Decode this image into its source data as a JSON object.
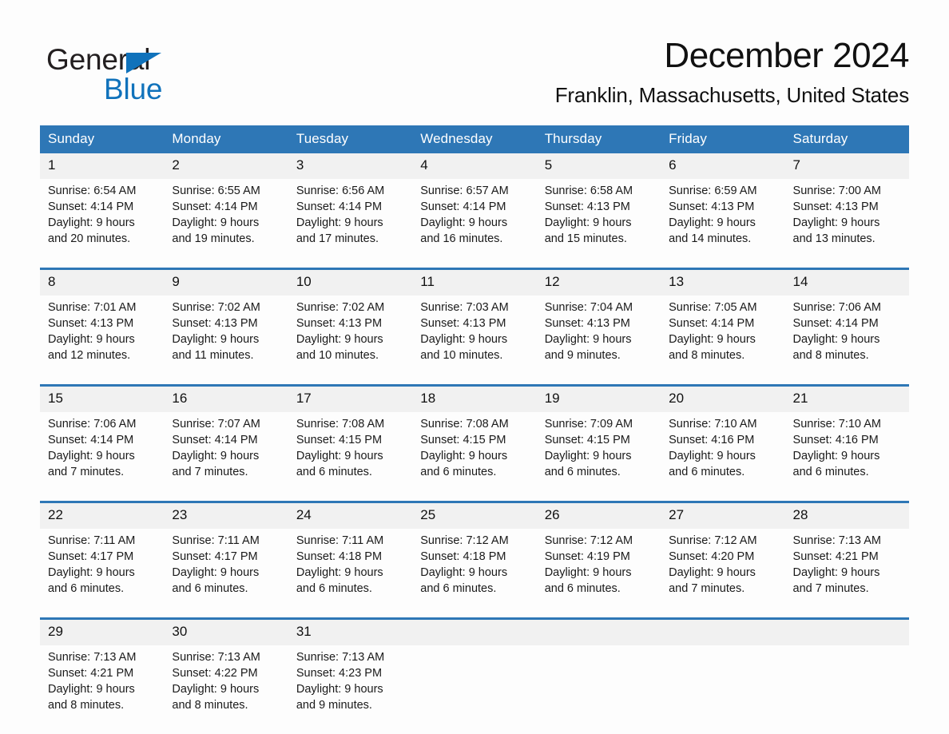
{
  "brand": {
    "name_part1": "General",
    "name_part2": "Blue",
    "triangle_color": "#1072bb",
    "text_color": "#231f20"
  },
  "header": {
    "title": "December 2024",
    "subtitle": "Franklin, Massachusetts, United States"
  },
  "theme": {
    "header_bg": "#2e77b6",
    "header_text": "#ffffff",
    "daynum_bg": "#f1f1f1",
    "page_bg": "#fdfdfd"
  },
  "calendar": {
    "weekday_headers": [
      "Sunday",
      "Monday",
      "Tuesday",
      "Wednesday",
      "Thursday",
      "Friday",
      "Saturday"
    ],
    "weeks": [
      {
        "days": [
          {
            "num": "1",
            "sunrise": "Sunrise: 6:54 AM",
            "sunset": "Sunset: 4:14 PM",
            "daylight_line1": "Daylight: 9 hours",
            "daylight_line2": "and 20 minutes."
          },
          {
            "num": "2",
            "sunrise": "Sunrise: 6:55 AM",
            "sunset": "Sunset: 4:14 PM",
            "daylight_line1": "Daylight: 9 hours",
            "daylight_line2": "and 19 minutes."
          },
          {
            "num": "3",
            "sunrise": "Sunrise: 6:56 AM",
            "sunset": "Sunset: 4:14 PM",
            "daylight_line1": "Daylight: 9 hours",
            "daylight_line2": "and 17 minutes."
          },
          {
            "num": "4",
            "sunrise": "Sunrise: 6:57 AM",
            "sunset": "Sunset: 4:14 PM",
            "daylight_line1": "Daylight: 9 hours",
            "daylight_line2": "and 16 minutes."
          },
          {
            "num": "5",
            "sunrise": "Sunrise: 6:58 AM",
            "sunset": "Sunset: 4:13 PM",
            "daylight_line1": "Daylight: 9 hours",
            "daylight_line2": "and 15 minutes."
          },
          {
            "num": "6",
            "sunrise": "Sunrise: 6:59 AM",
            "sunset": "Sunset: 4:13 PM",
            "daylight_line1": "Daylight: 9 hours",
            "daylight_line2": "and 14 minutes."
          },
          {
            "num": "7",
            "sunrise": "Sunrise: 7:00 AM",
            "sunset": "Sunset: 4:13 PM",
            "daylight_line1": "Daylight: 9 hours",
            "daylight_line2": "and 13 minutes."
          }
        ]
      },
      {
        "days": [
          {
            "num": "8",
            "sunrise": "Sunrise: 7:01 AM",
            "sunset": "Sunset: 4:13 PM",
            "daylight_line1": "Daylight: 9 hours",
            "daylight_line2": "and 12 minutes."
          },
          {
            "num": "9",
            "sunrise": "Sunrise: 7:02 AM",
            "sunset": "Sunset: 4:13 PM",
            "daylight_line1": "Daylight: 9 hours",
            "daylight_line2": "and 11 minutes."
          },
          {
            "num": "10",
            "sunrise": "Sunrise: 7:02 AM",
            "sunset": "Sunset: 4:13 PM",
            "daylight_line1": "Daylight: 9 hours",
            "daylight_line2": "and 10 minutes."
          },
          {
            "num": "11",
            "sunrise": "Sunrise: 7:03 AM",
            "sunset": "Sunset: 4:13 PM",
            "daylight_line1": "Daylight: 9 hours",
            "daylight_line2": "and 10 minutes."
          },
          {
            "num": "12",
            "sunrise": "Sunrise: 7:04 AM",
            "sunset": "Sunset: 4:13 PM",
            "daylight_line1": "Daylight: 9 hours",
            "daylight_line2": "and 9 minutes."
          },
          {
            "num": "13",
            "sunrise": "Sunrise: 7:05 AM",
            "sunset": "Sunset: 4:14 PM",
            "daylight_line1": "Daylight: 9 hours",
            "daylight_line2": "and 8 minutes."
          },
          {
            "num": "14",
            "sunrise": "Sunrise: 7:06 AM",
            "sunset": "Sunset: 4:14 PM",
            "daylight_line1": "Daylight: 9 hours",
            "daylight_line2": "and 8 minutes."
          }
        ]
      },
      {
        "days": [
          {
            "num": "15",
            "sunrise": "Sunrise: 7:06 AM",
            "sunset": "Sunset: 4:14 PM",
            "daylight_line1": "Daylight: 9 hours",
            "daylight_line2": "and 7 minutes."
          },
          {
            "num": "16",
            "sunrise": "Sunrise: 7:07 AM",
            "sunset": "Sunset: 4:14 PM",
            "daylight_line1": "Daylight: 9 hours",
            "daylight_line2": "and 7 minutes."
          },
          {
            "num": "17",
            "sunrise": "Sunrise: 7:08 AM",
            "sunset": "Sunset: 4:15 PM",
            "daylight_line1": "Daylight: 9 hours",
            "daylight_line2": "and 6 minutes."
          },
          {
            "num": "18",
            "sunrise": "Sunrise: 7:08 AM",
            "sunset": "Sunset: 4:15 PM",
            "daylight_line1": "Daylight: 9 hours",
            "daylight_line2": "and 6 minutes."
          },
          {
            "num": "19",
            "sunrise": "Sunrise: 7:09 AM",
            "sunset": "Sunset: 4:15 PM",
            "daylight_line1": "Daylight: 9 hours",
            "daylight_line2": "and 6 minutes."
          },
          {
            "num": "20",
            "sunrise": "Sunrise: 7:10 AM",
            "sunset": "Sunset: 4:16 PM",
            "daylight_line1": "Daylight: 9 hours",
            "daylight_line2": "and 6 minutes."
          },
          {
            "num": "21",
            "sunrise": "Sunrise: 7:10 AM",
            "sunset": "Sunset: 4:16 PM",
            "daylight_line1": "Daylight: 9 hours",
            "daylight_line2": "and 6 minutes."
          }
        ]
      },
      {
        "days": [
          {
            "num": "22",
            "sunrise": "Sunrise: 7:11 AM",
            "sunset": "Sunset: 4:17 PM",
            "daylight_line1": "Daylight: 9 hours",
            "daylight_line2": "and 6 minutes."
          },
          {
            "num": "23",
            "sunrise": "Sunrise: 7:11 AM",
            "sunset": "Sunset: 4:17 PM",
            "daylight_line1": "Daylight: 9 hours",
            "daylight_line2": "and 6 minutes."
          },
          {
            "num": "24",
            "sunrise": "Sunrise: 7:11 AM",
            "sunset": "Sunset: 4:18 PM",
            "daylight_line1": "Daylight: 9 hours",
            "daylight_line2": "and 6 minutes."
          },
          {
            "num": "25",
            "sunrise": "Sunrise: 7:12 AM",
            "sunset": "Sunset: 4:18 PM",
            "daylight_line1": "Daylight: 9 hours",
            "daylight_line2": "and 6 minutes."
          },
          {
            "num": "26",
            "sunrise": "Sunrise: 7:12 AM",
            "sunset": "Sunset: 4:19 PM",
            "daylight_line1": "Daylight: 9 hours",
            "daylight_line2": "and 6 minutes."
          },
          {
            "num": "27",
            "sunrise": "Sunrise: 7:12 AM",
            "sunset": "Sunset: 4:20 PM",
            "daylight_line1": "Daylight: 9 hours",
            "daylight_line2": "and 7 minutes."
          },
          {
            "num": "28",
            "sunrise": "Sunrise: 7:13 AM",
            "sunset": "Sunset: 4:21 PM",
            "daylight_line1": "Daylight: 9 hours",
            "daylight_line2": "and 7 minutes."
          }
        ]
      },
      {
        "days": [
          {
            "num": "29",
            "sunrise": "Sunrise: 7:13 AM",
            "sunset": "Sunset: 4:21 PM",
            "daylight_line1": "Daylight: 9 hours",
            "daylight_line2": "and 8 minutes."
          },
          {
            "num": "30",
            "sunrise": "Sunrise: 7:13 AM",
            "sunset": "Sunset: 4:22 PM",
            "daylight_line1": "Daylight: 9 hours",
            "daylight_line2": "and 8 minutes."
          },
          {
            "num": "31",
            "sunrise": "Sunrise: 7:13 AM",
            "sunset": "Sunset: 4:23 PM",
            "daylight_line1": "Daylight: 9 hours",
            "daylight_line2": "and 9 minutes."
          },
          {
            "num": "",
            "sunrise": "",
            "sunset": "",
            "daylight_line1": "",
            "daylight_line2": ""
          },
          {
            "num": "",
            "sunrise": "",
            "sunset": "",
            "daylight_line1": "",
            "daylight_line2": ""
          },
          {
            "num": "",
            "sunrise": "",
            "sunset": "",
            "daylight_line1": "",
            "daylight_line2": ""
          },
          {
            "num": "",
            "sunrise": "",
            "sunset": "",
            "daylight_line1": "",
            "daylight_line2": ""
          }
        ]
      }
    ]
  }
}
